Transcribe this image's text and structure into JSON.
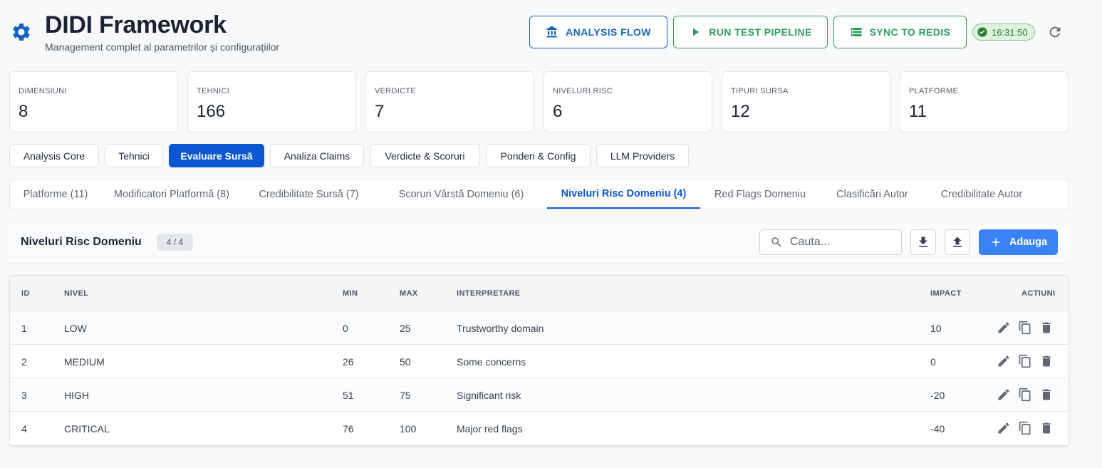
{
  "header": {
    "title": "DIDI Framework",
    "subtitle": "Management complet al parametrilor și configurațiilor",
    "buttons": {
      "analysis_flow": "ANALYSIS FLOW",
      "run_pipeline": "RUN TEST PIPELINE",
      "sync_redis": "SYNC TO REDIS"
    },
    "time": "16:31:50",
    "icons": {
      "logo": "gear-icon",
      "refresh": "refresh-icon",
      "status": "check-circle-icon"
    }
  },
  "stats": [
    {
      "label": "DIMENSIUNI",
      "value": "8"
    },
    {
      "label": "TEHNICI",
      "value": "166"
    },
    {
      "label": "VERDICTE",
      "value": "7"
    },
    {
      "label": "NIVELURI RISC",
      "value": "6"
    },
    {
      "label": "TIPURI SURSA",
      "value": "12"
    },
    {
      "label": "PLATFORME",
      "value": "11"
    }
  ],
  "categories": [
    {
      "label": "Analysis Core"
    },
    {
      "label": "Tehnici"
    },
    {
      "label": "Evaluare Sursă",
      "active": true
    },
    {
      "label": "Analiza Claims"
    },
    {
      "label": "Verdicte & Scoruri"
    },
    {
      "label": "Ponderi & Config"
    },
    {
      "label": "LLM Providers"
    }
  ],
  "subtabs": [
    {
      "label": "Platforme (11)"
    },
    {
      "label": "Modificatori Platformă (8)"
    },
    {
      "label": "Credibilitate Sursă (7)"
    },
    {
      "label": "Scoruri Vârstă Domeniu (6)"
    },
    {
      "label": "Niveluri Risc Domeniu (4)",
      "active": true
    },
    {
      "label": "Red Flags Domeniu"
    },
    {
      "label": "Clasificări Autor"
    },
    {
      "label": "Credibilitate Autor"
    }
  ],
  "panel": {
    "title": "Niveluri Risc Domeniu",
    "count": "4 / 4",
    "search_placeholder": "Cauta...",
    "add_label": "Adauga"
  },
  "table": {
    "columns": {
      "id": "ID",
      "nivel": "NIVEL",
      "min": "MIN",
      "max": "MAX",
      "interpretare": "INTERPRETARE",
      "impact": "IMPACT",
      "actiuni": "ACTIUNI"
    },
    "rows": [
      {
        "id": "1",
        "nivel": "LOW",
        "min": "0",
        "max": "25",
        "interpretare": "Trustworthy domain",
        "impact": "10"
      },
      {
        "id": "2",
        "nivel": "MEDIUM",
        "min": "26",
        "max": "50",
        "interpretare": "Some concerns",
        "impact": "0"
      },
      {
        "id": "3",
        "nivel": "HIGH",
        "min": "51",
        "max": "75",
        "interpretare": "Significant risk",
        "impact": "-20"
      },
      {
        "id": "4",
        "nivel": "CRITICAL",
        "min": "76",
        "max": "100",
        "interpretare": "Major red flags",
        "impact": "-40"
      }
    ]
  },
  "colors": {
    "primary": "#0b57d0",
    "accent_blue": "#3b82f6",
    "success": "#2e9e5b",
    "icon_gray": "#5f6874"
  }
}
